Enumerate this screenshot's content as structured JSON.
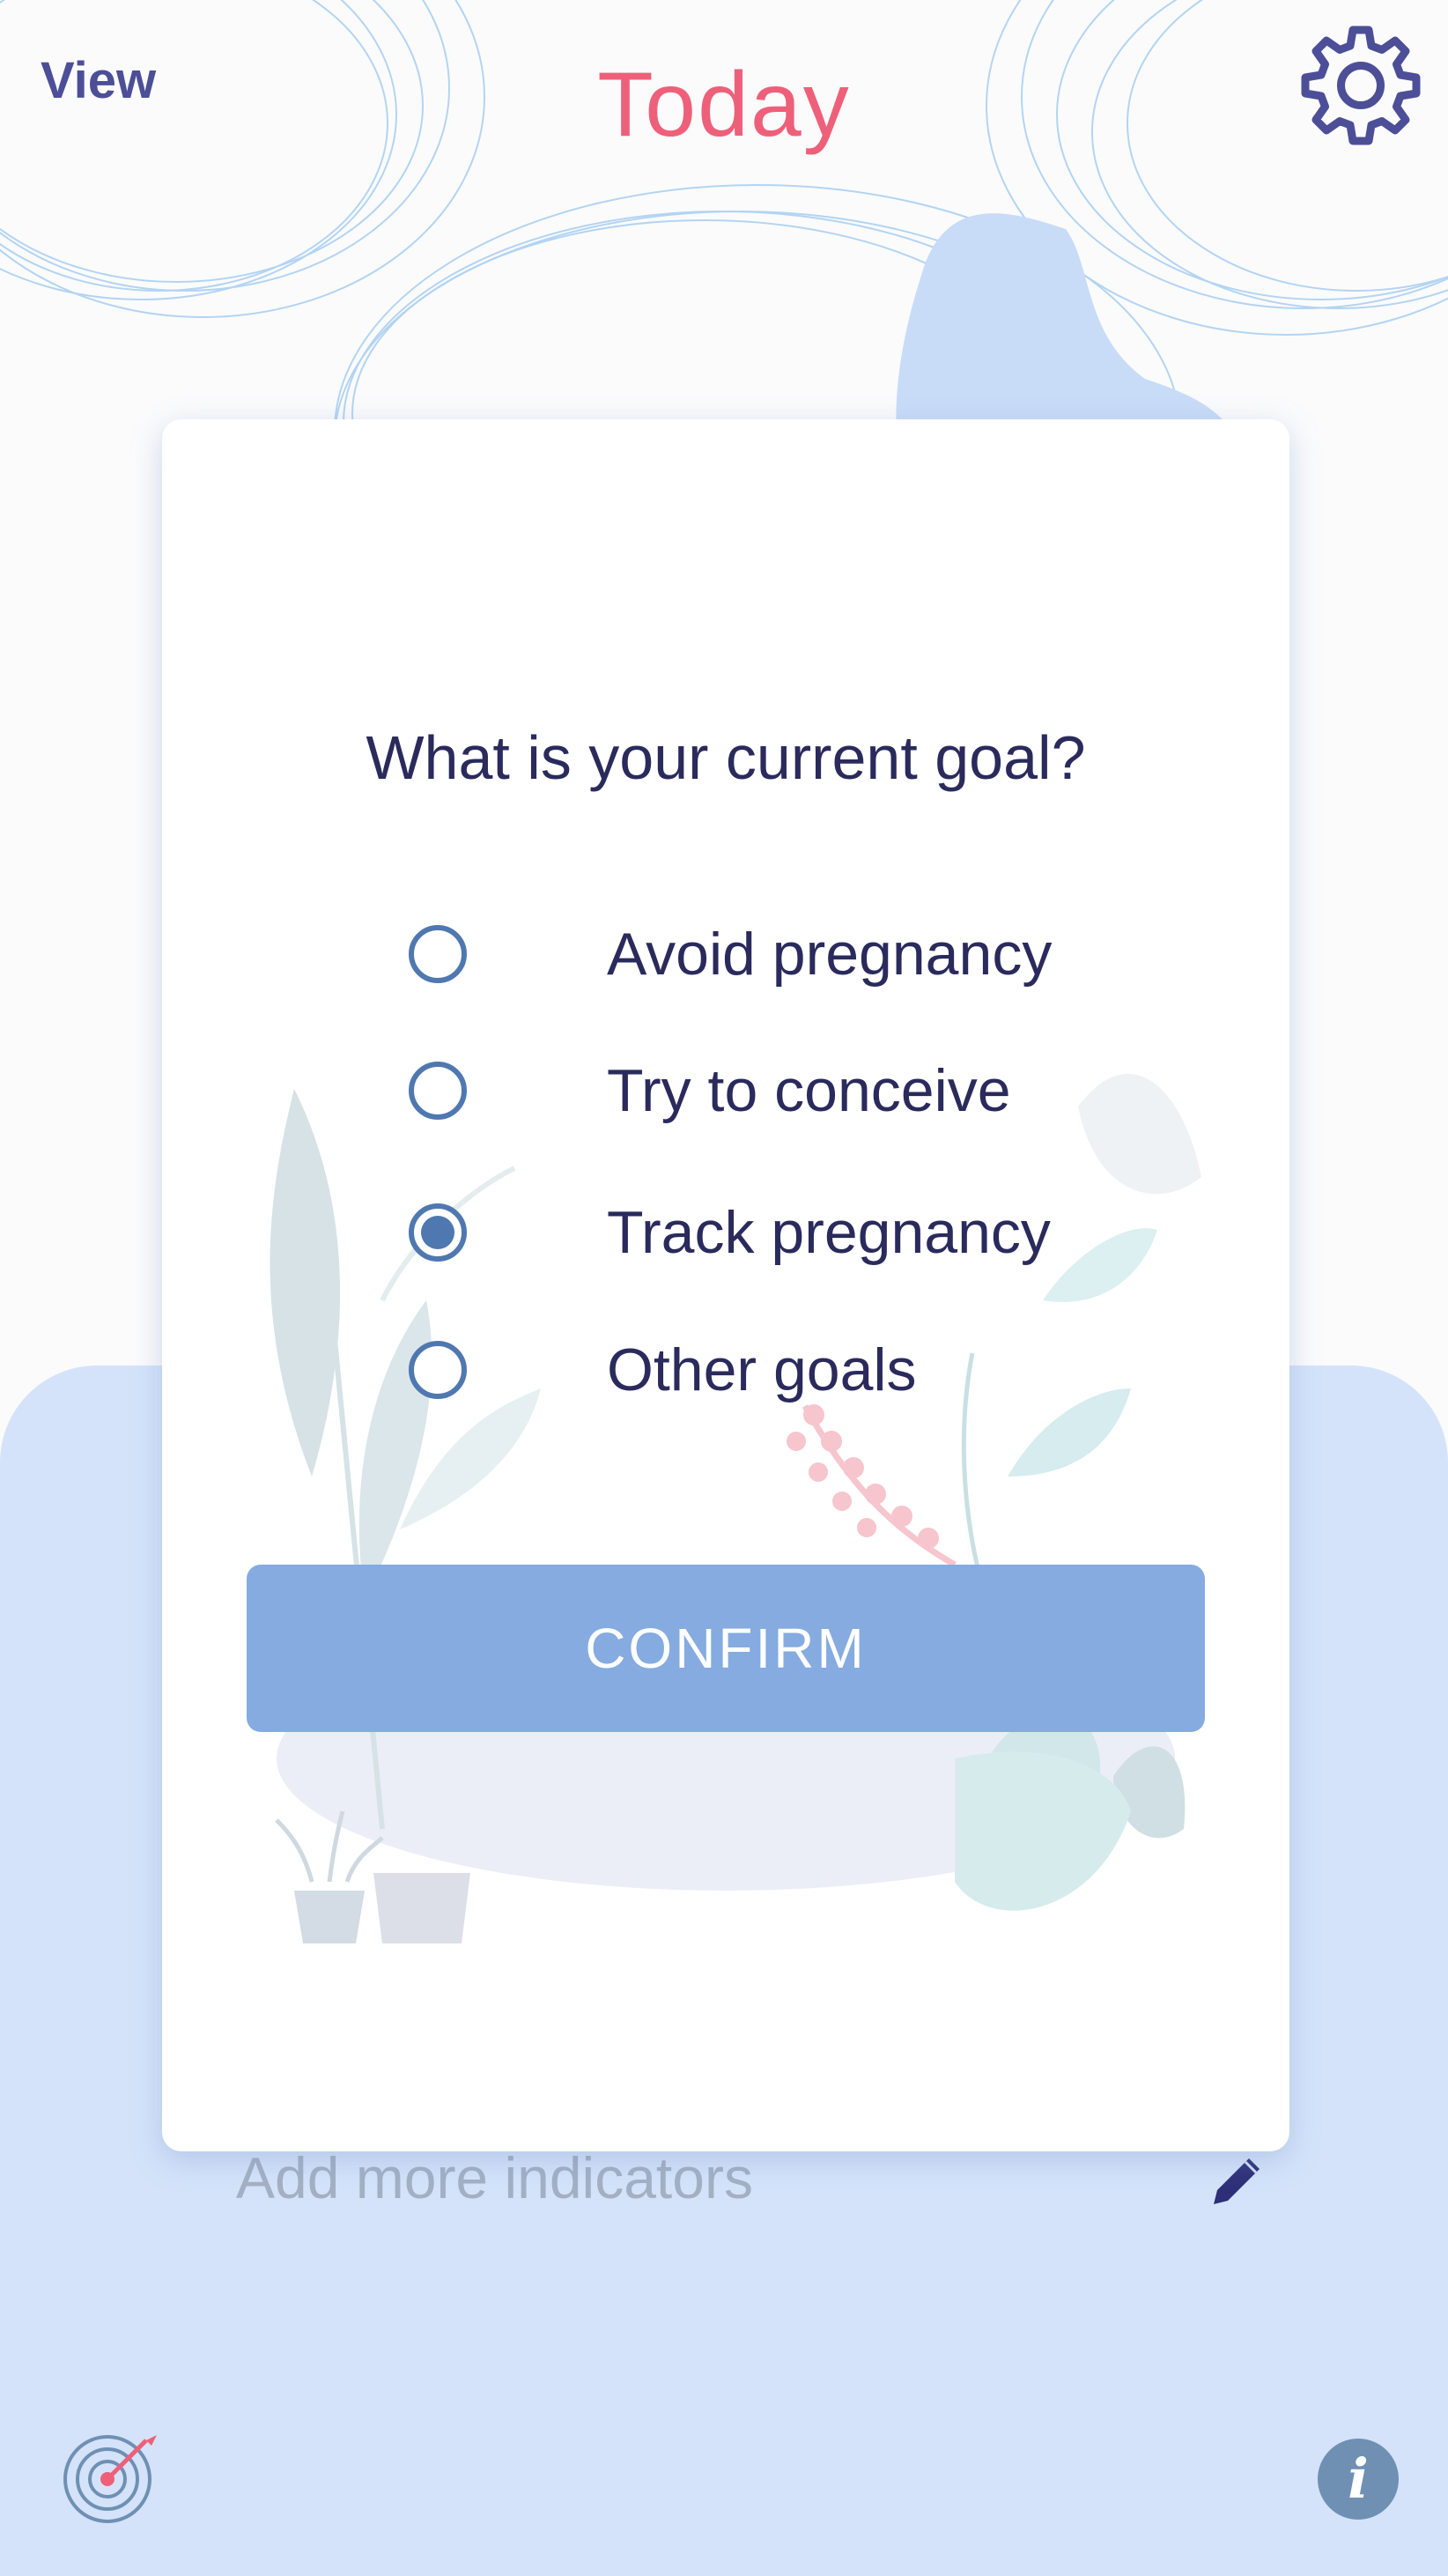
{
  "header": {
    "view_label": "View",
    "title": "Today"
  },
  "modal": {
    "question": "What is your current goal?",
    "options": [
      {
        "label": "Avoid pregnancy",
        "selected": false
      },
      {
        "label": "Try to conceive",
        "selected": false
      },
      {
        "label": "Track pregnancy",
        "selected": true
      },
      {
        "label": "Other goals",
        "selected": false
      }
    ],
    "confirm_label": "CONFIRM"
  },
  "underlay": {
    "add_indicators": "Add more indicators"
  },
  "footer": {
    "info_glyph": "i"
  },
  "icons": {
    "settings": "gear-icon",
    "edit": "pencil-icon",
    "goal": "target-icon",
    "info": "info-icon"
  },
  "colors": {
    "title": "#ee6079",
    "accent": "#4c4f97",
    "button": "#85abe0",
    "radio": "#4f78b0",
    "panel": "#d4e3fa"
  }
}
